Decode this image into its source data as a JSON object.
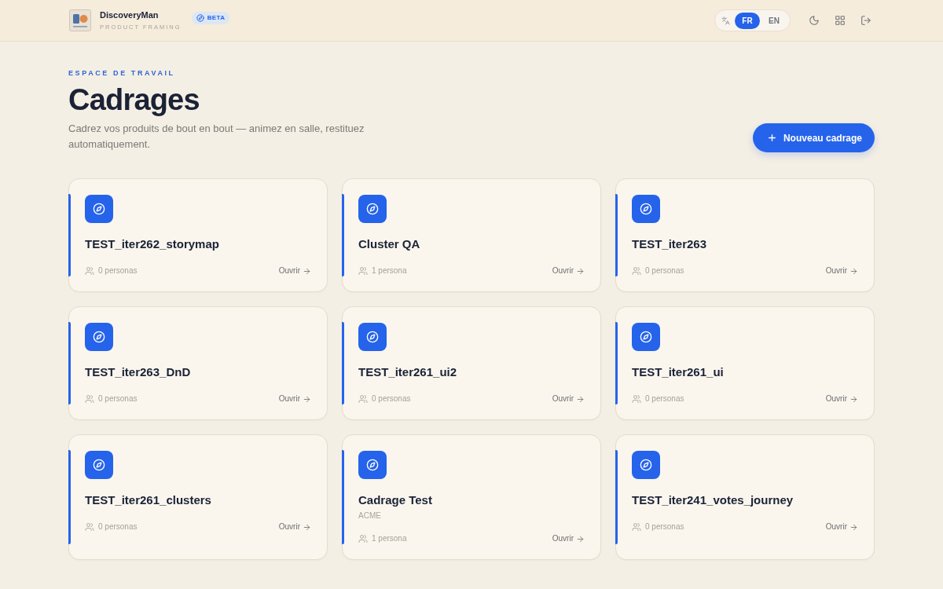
{
  "header": {
    "brand": {
      "name": "DiscoveryMan",
      "tagline": "PRODUCT FRAMING"
    },
    "badge": "BETA",
    "languages": [
      {
        "label": "FR",
        "selected": true
      },
      {
        "label": "EN",
        "selected": false
      }
    ]
  },
  "page": {
    "eyebrow": "ESPACE DE TRAVAIL",
    "title": "Cadrages",
    "description": "Cadrez vos produits de bout en bout — animez en salle, restituez automatiquement.",
    "new_button": "Nouveau cadrage"
  },
  "cards": [
    {
      "title": "TEST_iter262_storymap",
      "personas": "0 personas",
      "open": "Ouvrir"
    },
    {
      "title": "Cluster QA",
      "personas": "1 persona",
      "open": "Ouvrir"
    },
    {
      "title": "TEST_iter263",
      "personas": "0 personas",
      "open": "Ouvrir"
    },
    {
      "title": "TEST_iter263_DnD",
      "personas": "0 personas",
      "open": "Ouvrir"
    },
    {
      "title": "TEST_iter261_ui2",
      "personas": "0 personas",
      "open": "Ouvrir"
    },
    {
      "title": "TEST_iter261_ui",
      "personas": "0 personas",
      "open": "Ouvrir"
    },
    {
      "title": "TEST_iter261_clusters",
      "personas": "0 personas",
      "open": "Ouvrir"
    },
    {
      "title": "Cadrage Test",
      "subtitle": "ACME",
      "personas": "1 persona",
      "open": "Ouvrir"
    },
    {
      "title": "TEST_iter241_votes_journey",
      "personas": "0 personas",
      "open": "Ouvrir"
    }
  ]
}
